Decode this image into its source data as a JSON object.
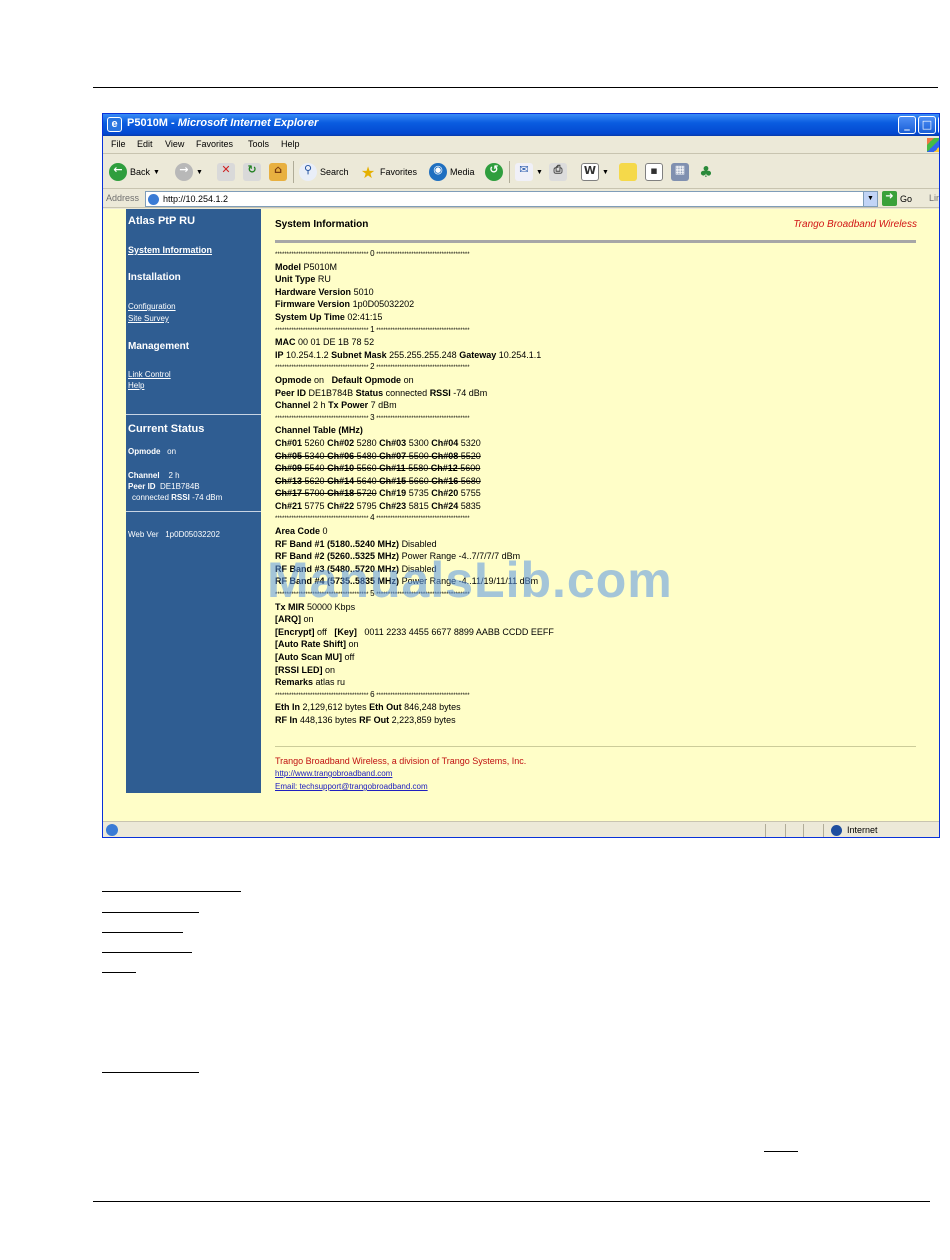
{
  "window": {
    "title_prefix": "P5010M - ",
    "title_app": "Microsoft Internet Explorer",
    "menu": [
      "File",
      "Edit",
      "View",
      "Favorites",
      "Tools",
      "Help"
    ],
    "toolbar": {
      "back": "Back",
      "search": "Search",
      "favorites": "Favorites",
      "media": "Media"
    },
    "address_label": "Address",
    "address_url": "http://10.254.1.2",
    "go": "Go",
    "links": "Lin",
    "status_zone": "Internet"
  },
  "sidebar": {
    "title": "Atlas PtP RU",
    "system_information": "System Information",
    "installation": "Installation",
    "configuration": "Configuration",
    "site_survey": "Site Survey",
    "management": "Management",
    "link_control": "Link Control",
    "help": "Help",
    "current_status": "Current Status",
    "opmode_label": "Opmode",
    "opmode_value": "on",
    "channel_label": "Channel",
    "channel_value": "2 h",
    "peer_label": "Peer ID",
    "peer_value": "DE1B784B",
    "connected_text": "connected",
    "rssi_label": "RSSI",
    "rssi_value": "-74 dBm",
    "webver_label": "Web Ver",
    "webver_value": "1p0D05032202"
  },
  "main": {
    "title": "System Information",
    "brand": "Trango Broadband Wireless",
    "stars": "****************************************",
    "sec0": "0",
    "model_label": "Model",
    "model_value": "P5010M",
    "unit_type_label": "Unit Type",
    "unit_type_value": "RU",
    "hw_label": "Hardware Version",
    "hw_value": "5010",
    "fw_label": "Firmware Version",
    "fw_value": "1p0D05032202",
    "uptime_label": "System Up Time",
    "uptime_value": "02:41:15",
    "sec1": "1",
    "mac_label": "MAC",
    "mac_value": "00 01 DE 1B 78 52",
    "ip_label": "IP",
    "ip_value": "10.254.1.2",
    "mask_label": "Subnet Mask",
    "mask_value": "255.255.255.248",
    "gw_label": "Gateway",
    "gw_value": "10.254.1.1",
    "sec2": "2",
    "opmode_label": "Opmode",
    "opmode_value": "on",
    "default_opmode_label": "Default Opmode",
    "default_opmode_value": "on",
    "peer_label": "Peer ID",
    "peer_value": "DE1B784B",
    "status_label": "Status",
    "status_value": "connected",
    "rssi_label": "RSSI",
    "rssi_value": "-74 dBm",
    "channel_label": "Channel",
    "channel_value": "2 h",
    "txpower_label": "Tx Power",
    "txpower_value": "7 dBm",
    "sec3": "3",
    "channel_table_label": "Channel Table (MHz)",
    "ch": [
      [
        "Ch#01",
        "5260",
        "Ch#02",
        "5280",
        "Ch#03",
        "5300",
        "Ch#04",
        "5320"
      ],
      [
        "Ch#05",
        "5340",
        "Ch#06",
        "5480",
        "Ch#07",
        "5500",
        "Ch#08",
        "5520"
      ],
      [
        "Ch#09",
        "5540",
        "Ch#10",
        "5560",
        "Ch#11",
        "5580",
        "Ch#12",
        "5600"
      ],
      [
        "Ch#13",
        "5620",
        "Ch#14",
        "5640",
        "Ch#15",
        "5660",
        "Ch#16",
        "5680"
      ],
      [
        "Ch#17",
        "5700",
        "Ch#18",
        "5720",
        "Ch#19",
        "5735",
        "Ch#20",
        "5755"
      ],
      [
        "Ch#21",
        "5775",
        "Ch#22",
        "5795",
        "Ch#23",
        "5815",
        "Ch#24",
        "5835"
      ]
    ],
    "sec4": "4",
    "area_code_label": "Area Code",
    "area_code_value": "0",
    "rf1_label": "RF Band #1 (5180..5240 MHz)",
    "rf1_value": "Disabled",
    "rf2_label": "RF Band #2 (5260..5325 MHz)",
    "rf2_power_label": "Power Range",
    "rf2_power_value": "-4..7/7/7/7 dBm",
    "rf3_label": "RF Band #3 (5480..5720 MHz)",
    "rf3_value": "Disabled",
    "rf4_label": "RF Band #4 (5735..5835 MHz)",
    "rf4_power_label": "Power Range",
    "rf4_power_value": "-4..11/19/11/11 dBm",
    "sec5": "5",
    "txmir_label": "Tx MIR",
    "txmir_value": "50000 Kbps",
    "arq_label": "[ARQ]",
    "arq_value": "on",
    "encrypt_label": "[Encrypt]",
    "encrypt_value": "off",
    "key_label": "[Key]",
    "key_value": "0011 2233 4455 6677 8899 AABB CCDD EEFF",
    "autorate_label": "[Auto Rate Shift]",
    "autorate_value": "on",
    "autoscan_label": "[Auto Scan MU]",
    "autoscan_value": "off",
    "rssiled_label": "[RSSI LED]",
    "rssiled_value": "on",
    "remarks_label": "Remarks",
    "remarks_value": "atlas ru",
    "sec6": "6",
    "ethin_label": "Eth In",
    "ethin_value": "2,129,612 bytes",
    "ethout_label": "Eth Out",
    "ethout_value": "846,248 bytes",
    "rfin_label": "RF In",
    "rfin_value": "448,136 bytes",
    "rfout_label": "RF Out",
    "rfout_value": "2,223,859 bytes",
    "footer_company": "Trango Broadband Wireless, a division of Trango Systems, Inc.",
    "footer_url": "http://www.trangobroadband.com",
    "footer_email": "Email: techsupport@trangobroadband.com"
  },
  "watermark": "ManualsLib.com"
}
